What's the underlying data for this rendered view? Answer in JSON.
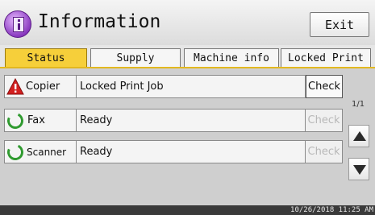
{
  "header": {
    "title": "Information",
    "exit_label": "Exit"
  },
  "tabs": [
    {
      "label": "Status",
      "active": true
    },
    {
      "label": "Supply",
      "active": false
    },
    {
      "label": "Machine info",
      "active": false
    },
    {
      "label": "Locked Print",
      "active": false
    }
  ],
  "rows": [
    {
      "name": "Copier",
      "status": "Locked Print Job",
      "check_label": "Check",
      "check_enabled": true,
      "icon": "warning-icon"
    },
    {
      "name": "Fax",
      "status": "Ready",
      "check_label": "Check",
      "check_enabled": false,
      "icon": "ready-icon"
    },
    {
      "name": "Scanner",
      "status": "Ready",
      "check_label": "Check",
      "check_enabled": false,
      "icon": "ready-icon"
    }
  ],
  "pager": {
    "indicator": "1/1"
  },
  "footer": {
    "datetime": "10/26/2018 11:25 AM"
  },
  "colors": {
    "active_tab": "#f6cf3a",
    "ready_green": "#2f9a2f",
    "warning_red": "#d21f1f"
  }
}
